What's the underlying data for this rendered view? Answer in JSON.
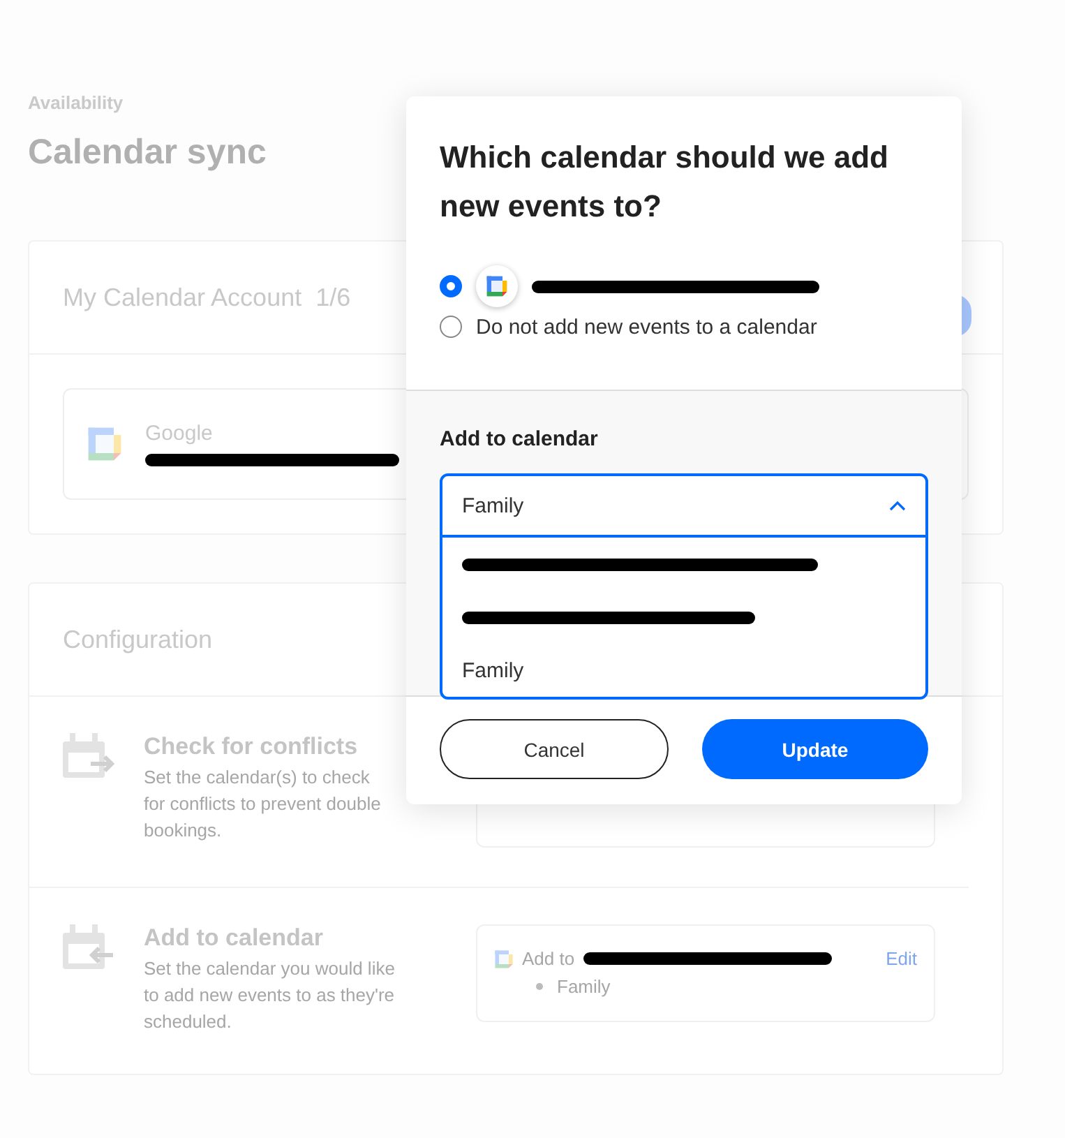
{
  "page": {
    "breadcrumb": "Availability",
    "title": "Calendar sync"
  },
  "account_card": {
    "title": "My Calendar Account",
    "count": "1/6",
    "account": {
      "provider": "Google",
      "email": {
        "kind": "redacted"
      }
    }
  },
  "configuration": {
    "title": "Configuration",
    "rows": [
      {
        "kind": "conflicts",
        "title": "Check for conflicts",
        "description": "Set the calendar(s) to check for conflicts to prevent double bookings."
      },
      {
        "kind": "add",
        "title": "Add to calendar",
        "description": "Set the calendar you would like to add new events to as they're scheduled.",
        "summary": {
          "prefix": "Add to",
          "calendars": [
            "Family"
          ],
          "action": "Edit"
        }
      }
    ]
  },
  "dialog": {
    "title": "Which calendar should we add new events to?",
    "options": [
      {
        "kind": "account",
        "selected": true
      },
      {
        "kind": "text",
        "label": "Do not add new events to a calendar",
        "selected": false
      }
    ],
    "section_label": "Add to calendar",
    "dropdown": {
      "value": "Family",
      "expanded": true,
      "options": [
        {
          "kind": "redacted"
        },
        {
          "kind": "redacted"
        },
        {
          "kind": "text",
          "label": "Family"
        }
      ]
    },
    "buttons": [
      {
        "kind": "secondary",
        "label": "Cancel"
      },
      {
        "kind": "primary",
        "label": "Update"
      }
    ]
  }
}
